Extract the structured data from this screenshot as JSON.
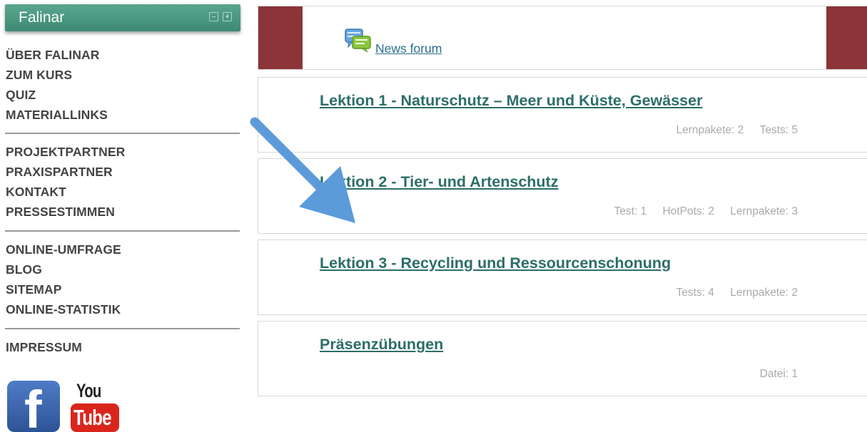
{
  "sidebar": {
    "block_title": "Falinar",
    "menu_group_1": [
      "ÜBER FALINAR",
      "ZUM KURS",
      "QUIZ",
      "MATERIALLINKS"
    ],
    "menu_group_2": [
      "PROJEKTPARTNER",
      "PRAXISPARTNER",
      "KONTAKT",
      "PRESSESTIMMEN"
    ],
    "menu_group_3": [
      "ONLINE-UMFRAGE",
      "BLOG",
      "SITEMAP",
      "ONLINE-STATISTIK"
    ],
    "menu_group_4": [
      "IMPRESSUM"
    ],
    "social": {
      "facebook_glyph": "f",
      "youtube_you": "You",
      "youtube_tube": "Tube"
    }
  },
  "main": {
    "news_forum_label": "News forum",
    "sections": [
      {
        "title": "Lektion 1 - Naturschutz – Meer und Küste, Gewässer",
        "stats": [
          "Lernpakete: 2",
          "Tests: 5"
        ]
      },
      {
        "title": "Lektion 2 - Tier- und Artenschutz",
        "stats": [
          "Test: 1",
          "HotPots: 2",
          "Lernpakete: 3"
        ]
      },
      {
        "title": "Lektion 3 - Recycling und Ressourcenschonung",
        "stats": [
          "Tests: 4",
          "Lernpakete: 2"
        ]
      },
      {
        "title": "Präsenzübungen",
        "stats": [
          "Datei: 1"
        ]
      }
    ]
  },
  "colors": {
    "header_green": "#4a9882",
    "maroon": "#8d3438",
    "link_teal": "#2c6e68",
    "arrow_blue": "#5b9bd9"
  },
  "icons": {
    "forum": "forum-chat-icon",
    "annotation": "blue-arrow-annotation"
  }
}
